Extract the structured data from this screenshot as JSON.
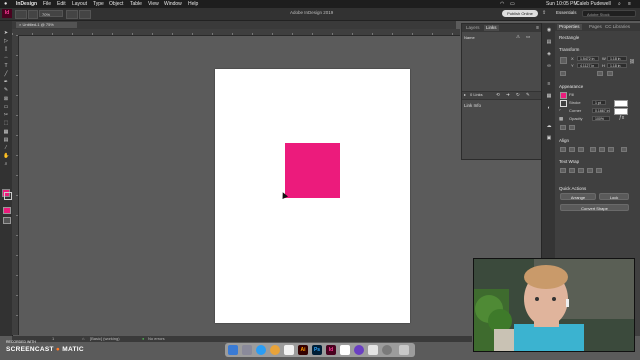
{
  "menubar": {
    "app_name": "InDesign",
    "items": [
      "File",
      "Edit",
      "Layout",
      "Type",
      "Object",
      "Table",
      "View",
      "Window",
      "Help"
    ],
    "clock": "Sun 10:05 PM",
    "user": "Caleb Pudewell"
  },
  "controlbar": {
    "zoom": "70%",
    "app_title": "Adobe InDesign 2019",
    "publish_label": "Publish Online",
    "workspace": "Essentials",
    "help_search_placeholder": "Adobe Stock"
  },
  "document": {
    "tab_label": "Untitled-1 @ 75%",
    "status_page": "1",
    "status_preset": "[Basic] (working)",
    "status_errors": "No errors",
    "rect_color": "#ec1b7c"
  },
  "links_panel": {
    "tabs": [
      "Layers",
      "Links"
    ],
    "active_tab": "Links",
    "column_name": "Name",
    "link_count": "0 Links",
    "link_info_label": "Link Info"
  },
  "properties": {
    "tabs": [
      "Properties",
      "Pages",
      "CC Libraries"
    ],
    "selection": "Rectangle",
    "transform_label": "Transform",
    "x_value": "1.5472 in",
    "y_value": "4.1127 in",
    "w_value": "1.18 in",
    "h_value": "1.18 in",
    "appearance_label": "Appearance",
    "fill_label": "Fill",
    "stroke_label": "Stroke",
    "stroke_weight": "1 pt",
    "corner_label": "Corner",
    "corner_value": "0.1667 in",
    "opacity_label": "Opacity",
    "opacity_value": "100%",
    "align_label": "Align",
    "text_wrap_label": "Text Wrap",
    "quick_actions_label": "Quick Actions",
    "arrange_label": "Arrange",
    "lock_label": "Lock",
    "convert_shape_label": "Convert Shape",
    "fill_color": "#ec1b7c"
  },
  "watermark": {
    "line1": "RECORDED WITH",
    "line2": "SCREENCAST",
    "line3": "MATIC"
  },
  "dock": {
    "icons": [
      "finder-icon",
      "launchpad-icon",
      "safari-icon",
      "chrome-icon",
      "photos-icon",
      "illustrator-icon",
      "photoshop-icon",
      "indesign-icon",
      "calendar-icon",
      "imovie-icon",
      "messages-icon",
      "settings-icon",
      "trash-icon"
    ],
    "ai_label": "Ai",
    "ps_label": "Ps",
    "id_label": "Id"
  }
}
